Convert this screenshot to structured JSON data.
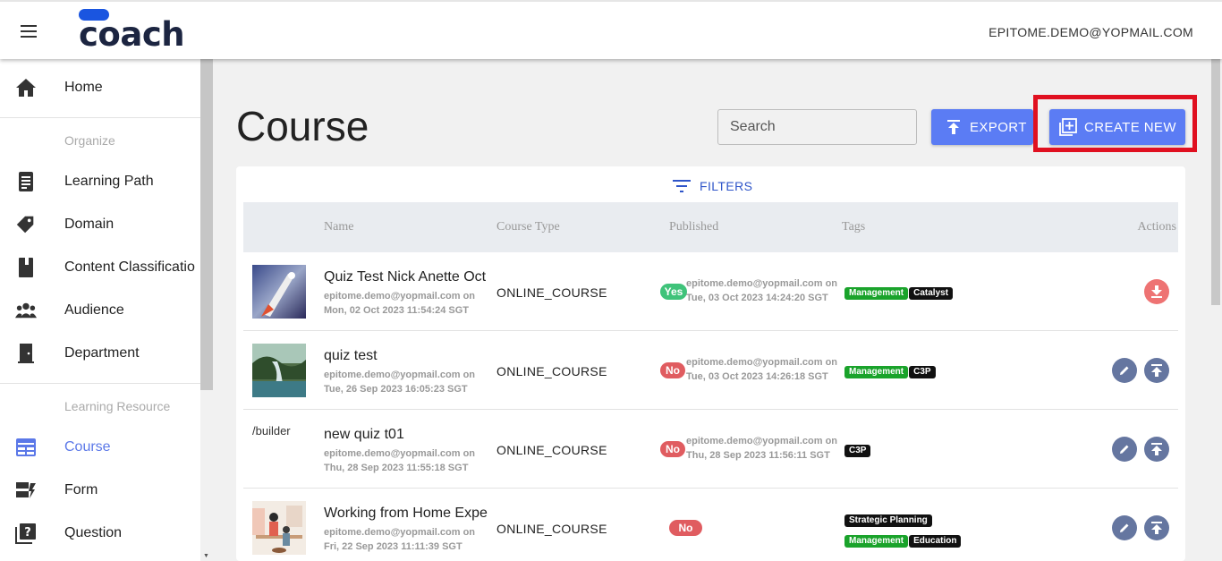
{
  "app": {
    "logo_text": "coach",
    "user_email": "EPITOME.DEMO@YOPMAIL.COM",
    "colors": {
      "accent": "#5b7cf4",
      "brand": "#1c2541",
      "highlight": "#e01020"
    }
  },
  "sidebar": {
    "items": [
      {
        "label": "Home",
        "icon": "home-icon"
      },
      {
        "label": "Learning Path",
        "icon": "document-icon"
      },
      {
        "label": "Domain",
        "icon": "tag-icon"
      },
      {
        "label": "Content Classificatio",
        "icon": "book-icon"
      },
      {
        "label": "Audience",
        "icon": "people-icon"
      },
      {
        "label": "Department",
        "icon": "door-icon"
      },
      {
        "label": "Course",
        "icon": "course-icon",
        "active": true
      },
      {
        "label": "Form",
        "icon": "form-icon"
      },
      {
        "label": "Question",
        "icon": "question-icon"
      }
    ],
    "sections": {
      "organize": "Organize",
      "learning_resource": "Learning Resource"
    }
  },
  "main": {
    "title": "Course",
    "search": {
      "placeholder": "Search",
      "value": ""
    },
    "export_label": "EXPORT",
    "create_label": "CREATE NEW",
    "filters_label": "FILTERS",
    "columns": [
      "Name",
      "Course Type",
      "Published",
      "Tags",
      "Actions"
    ],
    "rows": [
      {
        "name": "Quiz Test Nick Anette Oct",
        "created_by": "epitome.demo@yopmail.com on",
        "created_at": "Mon, 02 Oct 2023 11:54:24 SGT",
        "type": "ONLINE_COURSE",
        "published": "Yes",
        "published_by": "epitome.demo@yopmail.com on",
        "published_at": "Tue, 03 Oct 2023 14:24:20 SGT",
        "tags": [
          "Management",
          "Catalyst"
        ],
        "actions": [
          "download"
        ]
      },
      {
        "name": "quiz test",
        "created_by": "epitome.demo@yopmail.com on",
        "created_at": "Tue, 26 Sep 2023 16:05:23 SGT",
        "type": "ONLINE_COURSE",
        "published": "No",
        "published_by": "epitome.demo@yopmail.com on",
        "published_at": "Tue, 03 Oct 2023 14:26:18 SGT",
        "tags": [
          "Management",
          "C3P"
        ],
        "actions": [
          "edit",
          "publish"
        ]
      },
      {
        "name": "new quiz t01",
        "thumb_alt": "/builder",
        "created_by": "epitome.demo@yopmail.com on",
        "created_at": "Thu, 28 Sep 2023 11:55:18 SGT",
        "type": "ONLINE_COURSE",
        "published": "No",
        "published_by": "epitome.demo@yopmail.com on",
        "published_at": "Thu, 28 Sep 2023 11:56:11 SGT",
        "tags": [
          "C3P"
        ],
        "actions": [
          "edit",
          "publish"
        ]
      },
      {
        "name": "Working from Home Expe",
        "created_by": "epitome.demo@yopmail.com on",
        "created_at": "Fri, 22 Sep 2023 11:11:39 SGT",
        "type": "ONLINE_COURSE",
        "published": "No",
        "tags": [
          "Strategic Planning",
          "Management",
          "Education"
        ],
        "actions": [
          "edit",
          "publish"
        ]
      }
    ]
  }
}
